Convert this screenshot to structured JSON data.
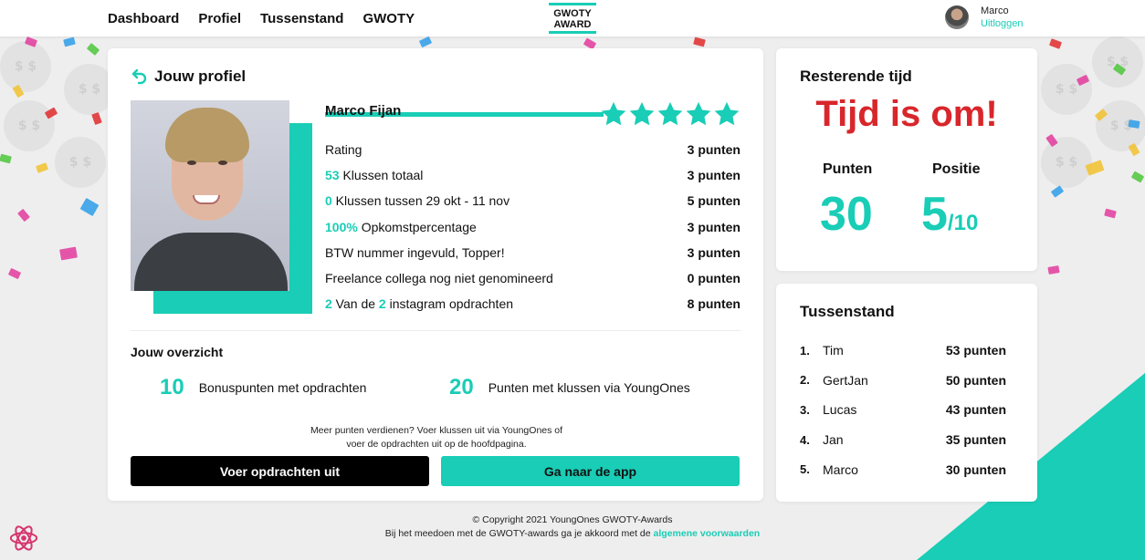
{
  "nav": {
    "links": [
      "Dashboard",
      "Profiel",
      "Tussenstand",
      "GWOTY"
    ],
    "logo_line1": "GWOTY",
    "logo_line2": "AWARD",
    "user_name": "Marco",
    "logout_label": "Uitloggen"
  },
  "profile": {
    "title": "Jouw profiel",
    "name": "Marco Fijan",
    "stars": 5,
    "rows": [
      {
        "highlight": "",
        "label": "Rating",
        "highlight2": "",
        "label2": "",
        "points": "3 punten"
      },
      {
        "highlight": "53",
        "label": " Klussen totaal",
        "highlight2": "",
        "label2": "",
        "points": "3 punten"
      },
      {
        "highlight": "0",
        "label": " Klussen tussen 29 okt - 11 nov",
        "highlight2": "",
        "label2": "",
        "points": "5 punten"
      },
      {
        "highlight": "100%",
        "label": " Opkomstpercentage",
        "highlight2": "",
        "label2": "",
        "points": "3 punten"
      },
      {
        "highlight": "",
        "label": "BTW nummer ingevuld, Topper!",
        "highlight2": "",
        "label2": "",
        "points": "3 punten"
      },
      {
        "highlight": "",
        "label": "Freelance collega nog niet genomineerd",
        "highlight2": "",
        "label2": "",
        "points": "0 punten"
      },
      {
        "highlight": "2",
        "label": " Van de ",
        "highlight2": "2",
        "label2": " instagram opdrachten",
        "points": "8 punten"
      }
    ],
    "overview_title": "Jouw overzicht",
    "overview": [
      {
        "value": "10",
        "label": "Bonuspunten met opdrachten"
      },
      {
        "value": "20",
        "label": "Punten met klussen via YoungOnes"
      }
    ],
    "hint_line1": "Meer punten verdienen? Voer klussen uit via YoungOnes of",
    "hint_line2": "voer de opdrachten uit op de hoofdpagina.",
    "btn_tasks": "Voer opdrachten uit",
    "btn_app": "Ga naar de app"
  },
  "time": {
    "title": "Resterende tijd",
    "status": "Tijd is om!",
    "points_label": "Punten",
    "points_value": "30",
    "position_label": "Positie",
    "position_value": "5",
    "position_total": "/10"
  },
  "standings": {
    "title": "Tussenstand",
    "items": [
      {
        "rank": "1.",
        "name": "Tim",
        "points": "53 punten"
      },
      {
        "rank": "2.",
        "name": "GertJan",
        "points": "50 punten"
      },
      {
        "rank": "3.",
        "name": "Lucas",
        "points": "43 punten"
      },
      {
        "rank": "4.",
        "name": "Jan",
        "points": "35 punten"
      },
      {
        "rank": "5.",
        "name": "Marco",
        "points": "30 punten"
      }
    ]
  },
  "footer": {
    "copyright": "© Copyright 2021 YoungOnes GWOTY-Awards",
    "terms_prefix": "Bij het meedoen met de GWOTY-awards ga je akkoord met de ",
    "terms_link": "algemene voorwaarden"
  },
  "colors": {
    "accent": "#19cdb6",
    "alert": "#d8262b",
    "background": "#eeeeee"
  },
  "icons": [
    "back-arrow-icon",
    "star-icon",
    "react-icon",
    "coin-icon"
  ]
}
